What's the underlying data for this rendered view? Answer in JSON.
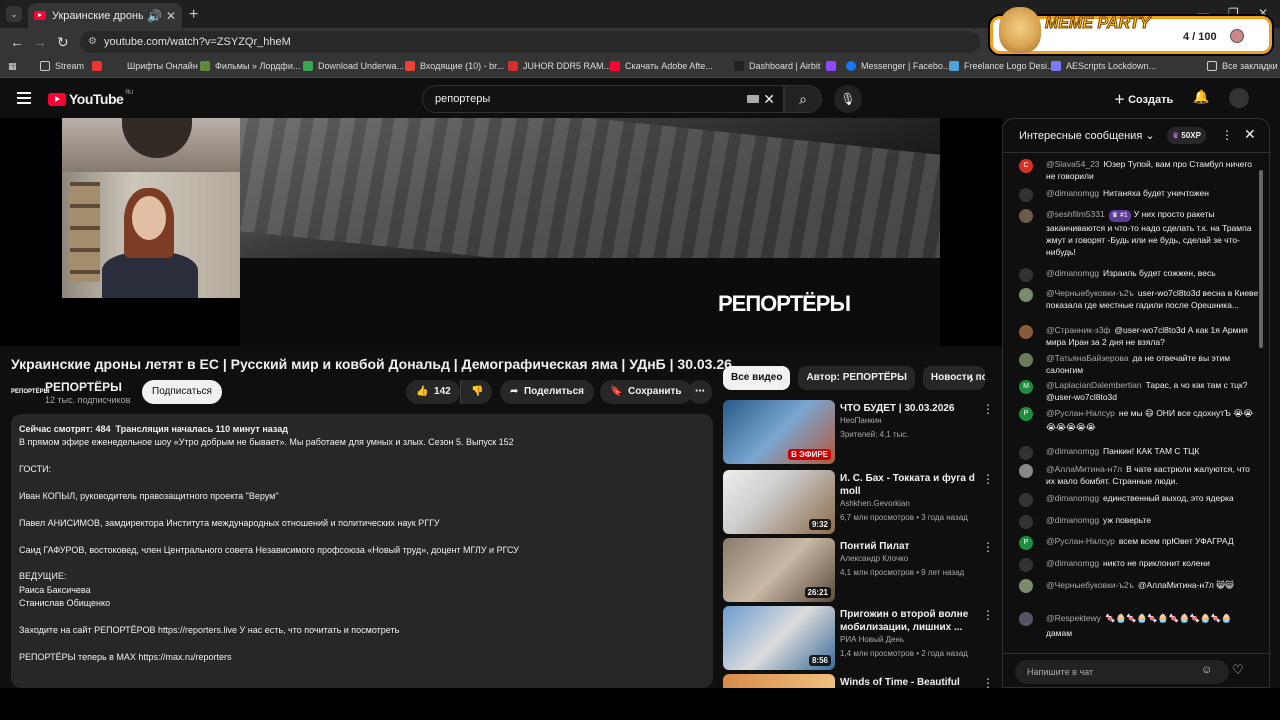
{
  "browser": {
    "tab_title": "Украинские дроны летят в",
    "url": "youtube.com/watch?v=ZSYZQr_hheM",
    "bookmarks": [
      "Stream",
      "Шрифты Онлайн",
      "Фильмы » Лордфи...",
      "Download Underwa...",
      "Входящие (10) - br...",
      "JUHOR DDR5 RAM...",
      "Скачать Adobe Afte...",
      "Dashboard | Airbit",
      "Messenger | Facebo...",
      "Freelance Logo Desi...",
      "AEScripts Lockdown...",
      "Все закладки"
    ]
  },
  "meme_party": {
    "title": "MEME PARTY",
    "count": "4 / 100"
  },
  "youtube": {
    "logo": "YouTube",
    "region": "RU",
    "search_value": "репортеры",
    "create_label": "Создать"
  },
  "video": {
    "overlay_logo": "РЕПОРТЁРЫ",
    "title": "Украинские дроны летят в ЕС | Русский мир и ковбой Дональд | Демографическая яма | УДнБ | 30.03.26",
    "channel_avatar_text": "РЕПОРТЁРЫ",
    "channel": "РЕПОРТЁРЫ",
    "subscribers": "12 тыс. подписчиков",
    "subscribe_label": "Подписаться",
    "likes": "142",
    "share_label": "Поделиться",
    "save_label": "Сохранить",
    "description_lines": [
      "Сейчас смотрят: 484  Трансляция началась 110 минут назад",
      "В прямом эфире еженедельное шоу «Утро добрым не бывает». Мы работаем для умных и злых. Сезон 5. Выпуск 152",
      "",
      "ГОСТИ:",
      "",
      "Иван КОПЫЛ, руководитель правозащитного проекта \"Верум\"",
      "",
      "Павел АНИСИМОВ, замдиректора Института международных отношений и политических наук РГГУ",
      "",
      "Саид ГАФУРОВ, востоковед, член Центрального совета Независимого профсоюза «Новый труд», доцент МГЛУ и РГСУ",
      "",
      "ВЕДУЩИЕ:",
      "Раиса Баксичева",
      "Станислав Обищенко",
      "",
      "Заходите на сайт РЕПОРТЁРОВ https://reporters.live У нас есть, что почитать и посмотреть",
      "",
      "РЕПОРТЁРЫ теперь в MAX https://max.ru/reporters"
    ]
  },
  "chips": [
    "Все видео",
    "Автор: РЕПОРТЁРЫ",
    "Новости по"
  ],
  "recommendations": [
    {
      "title": "ЧТО БУДЕТ | 30.03.2026",
      "channel": "НеоПанкин",
      "meta": "Зрителей: 4,1 тыс.",
      "badge": "В ЭФИРЕ"
    },
    {
      "title": "И. С. Бах - Токката и фуга d moll",
      "channel": "Ashkhen.Gevorkian",
      "meta": "6,7 млн просмотров • 3 года назад",
      "badge": "9:32"
    },
    {
      "title": "Понтий Пилат",
      "channel": "Александр Клочко",
      "meta": "4,1 млн просмотров • 9 лет назад",
      "badge": "26:21"
    },
    {
      "title": "Пригожин о второй волне мобилизации, лишних ...",
      "channel": "РИА Новый День",
      "meta": "1,4 млн просмотров • 2 года назад",
      "badge": "8:56"
    },
    {
      "title": "Winds of Time - Beautiful",
      "channel": "",
      "meta": "",
      "badge": ""
    }
  ],
  "chat": {
    "title": "Интересные сообщения",
    "xp": "50XP",
    "input_placeholder": "Напишите в чат",
    "messages": [
      {
        "user": "@Slava54_23",
        "text": "Юзер Тупой, вам про Стамбул ничего не говорили",
        "initial": "C",
        "color": "#d93025"
      },
      {
        "user": "@dimanomgg",
        "text": "Нитаняха будет уничтожен",
        "initial": "",
        "color": "#333333"
      },
      {
        "user": "@seshfilm5331",
        "badge": "#1",
        "text": "У них просто ракеты заканчиваются и что-то надо сделать т.к. на Трампа жмут и говорят -Будь или не будь, сделай зе что-нибудь!",
        "initial": "",
        "color": "#6b5a4a"
      },
      {
        "user": "@dimanomgg",
        "text": "Израиль будет сожжен, весь",
        "initial": "",
        "color": "#333333"
      },
      {
        "user": "@Черныебуковки-ъ2ъ",
        "text": "user-wo7cl8to3d весна в Киеве показала где местные гадили после Орешника...",
        "initial": "",
        "color": "#7a8a6a"
      },
      {
        "user": "@Странник-з3ф",
        "text": "@user-wo7cl8to3d А как 1я Армия мира Иран за 2 дня не взяла?",
        "initial": "",
        "color": "#8a5a3a"
      },
      {
        "user": "@ТатьянаБайзерова",
        "text": "да не отвечайте вы этим салонгим",
        "initial": "",
        "color": "#6a7a5a"
      },
      {
        "user": "@LaplacianDalembertian",
        "text": "Тарас, а чо как там с тцк? @user-wo7cl8to3d",
        "initial": "M",
        "color": "#1e8e3e"
      },
      {
        "user": "@Руслан-Налсур",
        "text": "не мы 😄 ОНИ все сдохнутЪ 😭😭😭😭😭😭😭",
        "initial": "P",
        "color": "#1e8e3e"
      },
      {
        "user": "@dimanomgg",
        "text": "Панкин! КАК ТАМ С ТЦК",
        "initial": "",
        "color": "#333333"
      },
      {
        "user": "@АллаМитина-н7л",
        "text": "В чате кастрюли жалуются, что их мало бомбят. Странные люди.",
        "initial": "",
        "color": "#888888"
      },
      {
        "user": "@dimanomgg",
        "text": "единственный выход, это ядерка",
        "initial": "",
        "color": "#333333"
      },
      {
        "user": "@dimanomgg",
        "text": "уж поверьте",
        "initial": "",
        "color": "#333333"
      },
      {
        "user": "@Руслан-Налсур",
        "text": "всем всем прЮвет УФАГРАД",
        "initial": "P",
        "color": "#1e8e3e"
      },
      {
        "user": "@dimanomgg",
        "text": "никто не приклонит колени",
        "initial": "",
        "color": "#333333"
      },
      {
        "user": "@Черныебуковки-ъ2ъ",
        "text": "@АллаМитина-н7л 😸😸",
        "initial": "",
        "color": "#7a8a6a"
      },
      {
        "user": "@Respektewy",
        "text": "🍬🧁🍬🧁🍬🧁🍬🧁🍬🧁🍬🧁 дамам",
        "initial": "",
        "color": "#555566"
      }
    ]
  }
}
